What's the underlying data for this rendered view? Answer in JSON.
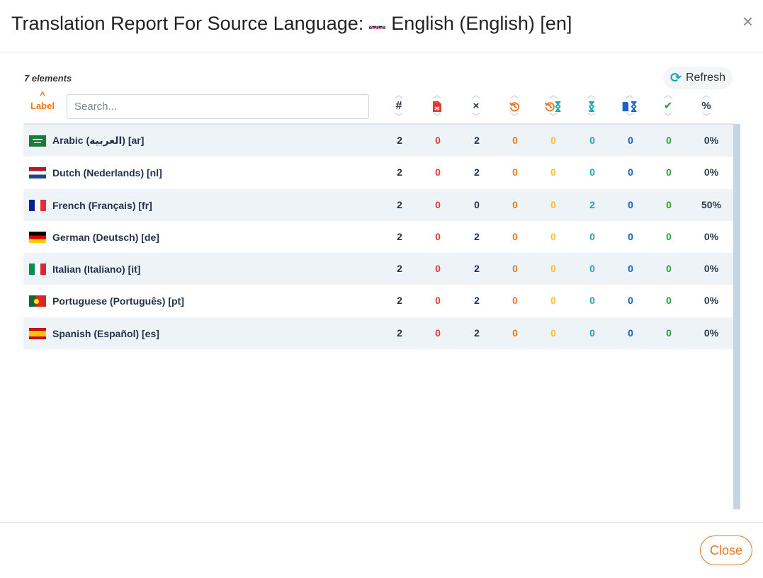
{
  "header": {
    "title_prefix": "Translation Report For Source Language:",
    "source_language": "English (English) [en]",
    "source_flag": "gb-flag-icon",
    "close_icon": "×"
  },
  "toolbar": {
    "count_text": "7 elements",
    "refresh_icon": "⟳",
    "refresh_label": "Refresh"
  },
  "filter": {
    "sort_label": "Label",
    "search_placeholder": "Search..."
  },
  "columns": [
    {
      "key": "total",
      "icon": "#",
      "color": "#24324a"
    },
    {
      "key": "error",
      "icon": "file-error-icon",
      "color": "#e53935"
    },
    {
      "key": "missing",
      "icon": "×",
      "color": "#24324a"
    },
    {
      "key": "outdated",
      "icon": "history-icon",
      "color": "#e8771e"
    },
    {
      "key": "outdated_pending",
      "icon": "history-hourglass-icon",
      "color": "#e8771e"
    },
    {
      "key": "pending",
      "icon": "hourglass-icon",
      "color": "#1ea5b5"
    },
    {
      "key": "proofread_pending",
      "icon": "book-hourglass-icon",
      "color": "#1565c0"
    },
    {
      "key": "validated",
      "icon": "✔",
      "color": "#2e9e3b"
    },
    {
      "key": "percent",
      "icon": "%",
      "color": "#2f3b4a"
    }
  ],
  "rows": [
    {
      "label": "Arabic (العربية) [ar]",
      "flag": "sa",
      "values": [
        "2",
        "0",
        "2",
        "0",
        "0",
        "0",
        "0",
        "0",
        "0%"
      ]
    },
    {
      "label": "Dutch (Nederlands) [nl]",
      "flag": "nl",
      "values": [
        "2",
        "0",
        "2",
        "0",
        "0",
        "0",
        "0",
        "0",
        "0%"
      ]
    },
    {
      "label": "French (Français) [fr]",
      "flag": "fr",
      "values": [
        "2",
        "0",
        "0",
        "0",
        "0",
        "2",
        "0",
        "0",
        "50%"
      ]
    },
    {
      "label": "German (Deutsch) [de]",
      "flag": "de",
      "values": [
        "2",
        "0",
        "2",
        "0",
        "0",
        "0",
        "0",
        "0",
        "0%"
      ]
    },
    {
      "label": "Italian (Italiano) [it]",
      "flag": "it",
      "values": [
        "2",
        "0",
        "2",
        "0",
        "0",
        "0",
        "0",
        "0",
        "0%"
      ]
    },
    {
      "label": "Portuguese (Português) [pt]",
      "flag": "pt",
      "values": [
        "2",
        "0",
        "2",
        "0",
        "0",
        "0",
        "0",
        "0",
        "0%"
      ]
    },
    {
      "label": "Spanish (Español) [es]",
      "flag": "es",
      "values": [
        "2",
        "0",
        "2",
        "0",
        "0",
        "0",
        "0",
        "0",
        "0%"
      ]
    }
  ],
  "footer": {
    "close_label": "Close"
  }
}
